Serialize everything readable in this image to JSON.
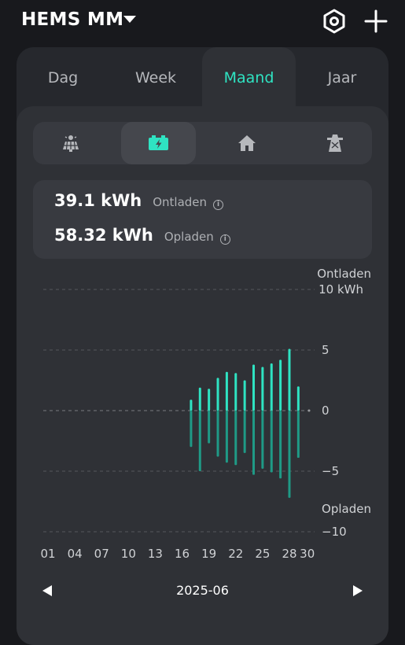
{
  "header": {
    "title": "HEMS MM"
  },
  "tabs": [
    {
      "label": "Dag",
      "active": false
    },
    {
      "label": "Week",
      "active": false
    },
    {
      "label": "Maand",
      "active": true
    },
    {
      "label": "Jaar",
      "active": false
    }
  ],
  "categories": [
    {
      "icon": "solar-panel-icon",
      "active": false
    },
    {
      "icon": "battery-icon",
      "active": true
    },
    {
      "icon": "home-icon",
      "active": false
    },
    {
      "icon": "grid-tower-icon",
      "active": false
    }
  ],
  "summary": {
    "discharge_value": "39.1 kWh",
    "discharge_label": "Ontladen",
    "charge_value": "58.32 kWh",
    "charge_label": "Opladen"
  },
  "colors": {
    "accent": "#2fe3c2",
    "discharge": "#2fe3c2",
    "charge": "#1f9a86"
  },
  "chart_data": {
    "type": "bar",
    "top_label": "Ontladen",
    "bottom_label": "Opladen",
    "y_ticks": [
      "10 kWh",
      "5",
      "0",
      "−5",
      "−10"
    ],
    "ylim": [
      -10,
      10
    ],
    "x_tick_labels": [
      "01",
      "04",
      "07",
      "10",
      "13",
      "16",
      "19",
      "22",
      "25",
      "28",
      "30"
    ],
    "x_tick_days": [
      1,
      4,
      7,
      10,
      13,
      16,
      19,
      22,
      25,
      28,
      30
    ],
    "grid": true,
    "series": [
      {
        "name": "Ontladen",
        "days": [
          17,
          18,
          19,
          20,
          21,
          22,
          23,
          24,
          25,
          26,
          27,
          28,
          29
        ],
        "values": [
          0.9,
          1.9,
          1.8,
          2.7,
          3.2,
          3.1,
          2.5,
          3.8,
          3.6,
          3.9,
          4.2,
          5.1,
          2.0
        ]
      },
      {
        "name": "Opladen",
        "days": [
          17,
          18,
          19,
          20,
          21,
          22,
          23,
          24,
          25,
          26,
          27,
          28,
          29
        ],
        "values": [
          -3.0,
          -5.0,
          -2.7,
          -3.8,
          -4.3,
          -4.5,
          -3.5,
          -5.3,
          -4.8,
          -5.1,
          -5.6,
          -7.2,
          -3.9
        ]
      }
    ],
    "period": "2025-06"
  }
}
